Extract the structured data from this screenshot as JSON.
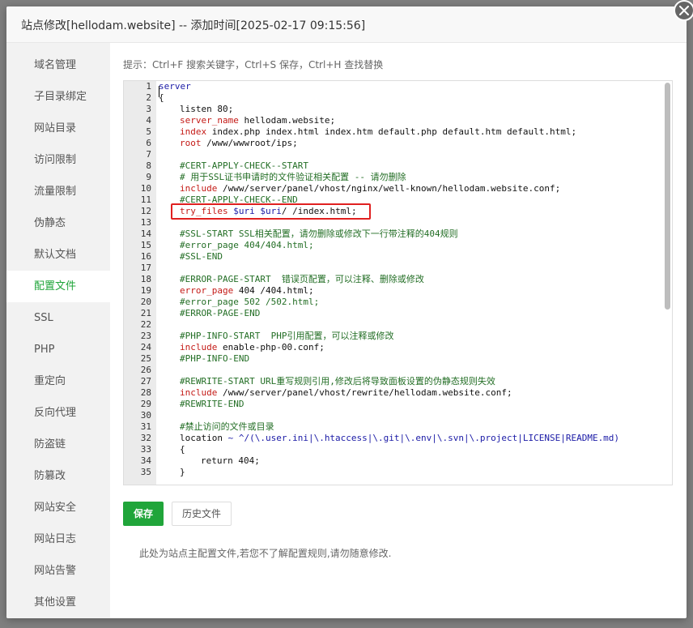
{
  "dialog": {
    "title": "站点修改[hellodam.website] -- 添加时间[2025-02-17 09:15:56]"
  },
  "sidebar": {
    "items": [
      {
        "label": "域名管理"
      },
      {
        "label": "子目录绑定"
      },
      {
        "label": "网站目录"
      },
      {
        "label": "访问限制"
      },
      {
        "label": "流量限制"
      },
      {
        "label": "伪静态"
      },
      {
        "label": "默认文档"
      },
      {
        "label": "配置文件",
        "active": true
      },
      {
        "label": "SSL"
      },
      {
        "label": "PHP"
      },
      {
        "label": "重定向"
      },
      {
        "label": "反向代理"
      },
      {
        "label": "防盗链"
      },
      {
        "label": "防篡改"
      },
      {
        "label": "网站安全"
      },
      {
        "label": "网站日志"
      },
      {
        "label": "网站告警"
      },
      {
        "label": "其他设置"
      }
    ]
  },
  "main": {
    "hint": "提示：Ctrl+F 搜索关键字，Ctrl+S 保存，Ctrl+H 查找替换",
    "save_label": "保存",
    "history_label": "历史文件",
    "footer_note": "此处为站点主配置文件,若您不了解配置规则,请勿随意修改."
  },
  "editor": {
    "line_numbers": [
      "1",
      "2",
      "3",
      "4",
      "5",
      "6",
      "7",
      "8",
      "9",
      "10",
      "11",
      "12",
      "13",
      "14",
      "15",
      "16",
      "17",
      "18",
      "19",
      "20",
      "21",
      "22",
      "23",
      "24",
      "25",
      "26",
      "27",
      "28",
      "29",
      "30",
      "31",
      "32",
      "33",
      "34",
      "35"
    ],
    "lines": [
      {
        "indent": 0,
        "parts": [
          {
            "t": "server",
            "c": "kw"
          }
        ]
      },
      {
        "indent": 0,
        "parts": [
          {
            "t": "{",
            "c": "pl"
          }
        ]
      },
      {
        "indent": 1,
        "parts": [
          {
            "t": "listen 80;",
            "c": "pl"
          }
        ]
      },
      {
        "indent": 1,
        "parts": [
          {
            "t": "server_name",
            "c": "va"
          },
          {
            "t": " hellodam.website;",
            "c": "pl"
          }
        ]
      },
      {
        "indent": 1,
        "parts": [
          {
            "t": "index",
            "c": "va"
          },
          {
            "t": " index.php index.html index.htm default.php default.htm default.html;",
            "c": "pl"
          }
        ]
      },
      {
        "indent": 1,
        "parts": [
          {
            "t": "root",
            "c": "va"
          },
          {
            "t": " /www/wwwroot/ips;",
            "c": "pl"
          }
        ]
      },
      {
        "indent": 0,
        "parts": [
          {
            "t": "",
            "c": "pl"
          }
        ]
      },
      {
        "indent": 1,
        "parts": [
          {
            "t": "#CERT-APPLY-CHECK--START",
            "c": "cm"
          }
        ]
      },
      {
        "indent": 1,
        "parts": [
          {
            "t": "# 用于SSL证书申请时的文件验证相关配置 -- 请勿删除",
            "c": "cm"
          }
        ]
      },
      {
        "indent": 1,
        "parts": [
          {
            "t": "include",
            "c": "va"
          },
          {
            "t": " /www/server/panel/vhost/nginx/well-known/hellodam.website.conf;",
            "c": "pl"
          }
        ]
      },
      {
        "indent": 1,
        "parts": [
          {
            "t": "#CERT-APPLY-CHECK--END",
            "c": "cm"
          }
        ]
      },
      {
        "indent": 1,
        "parts": [
          {
            "t": "try_files",
            "c": "va"
          },
          {
            "t": " ",
            "c": "pl"
          },
          {
            "t": "$uri",
            "c": "kw"
          },
          {
            "t": " ",
            "c": "pl"
          },
          {
            "t": "$uri",
            "c": "kw"
          },
          {
            "t": "/ /index.html;",
            "c": "pl"
          }
        ]
      },
      {
        "indent": 0,
        "parts": [
          {
            "t": "",
            "c": "pl"
          }
        ]
      },
      {
        "indent": 1,
        "parts": [
          {
            "t": "#SSL-START SSL相关配置，请勿删除或修改下一行带注释的404规则",
            "c": "cm"
          }
        ]
      },
      {
        "indent": 1,
        "parts": [
          {
            "t": "#error_page 404/404.html;",
            "c": "cm"
          }
        ]
      },
      {
        "indent": 1,
        "parts": [
          {
            "t": "#SSL-END",
            "c": "cm"
          }
        ]
      },
      {
        "indent": 0,
        "parts": [
          {
            "t": "",
            "c": "pl"
          }
        ]
      },
      {
        "indent": 1,
        "parts": [
          {
            "t": "#ERROR-PAGE-START  错误页配置，可以注释、删除或修改",
            "c": "cm"
          }
        ]
      },
      {
        "indent": 1,
        "parts": [
          {
            "t": "error_page",
            "c": "va"
          },
          {
            "t": " 404 /404.html;",
            "c": "pl"
          }
        ]
      },
      {
        "indent": 1,
        "parts": [
          {
            "t": "#error_page 502 /502.html;",
            "c": "cm"
          }
        ]
      },
      {
        "indent": 1,
        "parts": [
          {
            "t": "#ERROR-PAGE-END",
            "c": "cm"
          }
        ]
      },
      {
        "indent": 0,
        "parts": [
          {
            "t": "",
            "c": "pl"
          }
        ]
      },
      {
        "indent": 1,
        "parts": [
          {
            "t": "#PHP-INFO-START  PHP引用配置，可以注释或修改",
            "c": "cm"
          }
        ]
      },
      {
        "indent": 1,
        "parts": [
          {
            "t": "include",
            "c": "va"
          },
          {
            "t": " enable-php-00.conf;",
            "c": "pl"
          }
        ]
      },
      {
        "indent": 1,
        "parts": [
          {
            "t": "#PHP-INFO-END",
            "c": "cm"
          }
        ]
      },
      {
        "indent": 0,
        "parts": [
          {
            "t": "",
            "c": "pl"
          }
        ]
      },
      {
        "indent": 1,
        "parts": [
          {
            "t": "#REWRITE-START URL重写规则引用,修改后将导致面板设置的伪静态规则失效",
            "c": "cm"
          }
        ]
      },
      {
        "indent": 1,
        "parts": [
          {
            "t": "include",
            "c": "va"
          },
          {
            "t": " /www/server/panel/vhost/rewrite/hellodam.website.conf;",
            "c": "pl"
          }
        ]
      },
      {
        "indent": 1,
        "parts": [
          {
            "t": "#REWRITE-END",
            "c": "cm"
          }
        ]
      },
      {
        "indent": 0,
        "parts": [
          {
            "t": "",
            "c": "pl"
          }
        ]
      },
      {
        "indent": 1,
        "parts": [
          {
            "t": "#禁止访问的文件或目录",
            "c": "cm"
          }
        ]
      },
      {
        "indent": 1,
        "parts": [
          {
            "t": "location",
            "c": "pl"
          },
          {
            "t": " ~ ^/(\\.user.ini|\\.htaccess|\\.git|\\.env|\\.svn|\\.project|LICENSE|README.md)",
            "c": "kw"
          }
        ]
      },
      {
        "indent": 1,
        "parts": [
          {
            "t": "{",
            "c": "pl"
          }
        ]
      },
      {
        "indent": 2,
        "parts": [
          {
            "t": "return 404;",
            "c": "pl"
          }
        ]
      },
      {
        "indent": 1,
        "parts": [
          {
            "t": "}",
            "c": "pl"
          }
        ]
      }
    ]
  },
  "colors": {
    "accent": "#20a53a",
    "highlight_box": "#e02020"
  }
}
